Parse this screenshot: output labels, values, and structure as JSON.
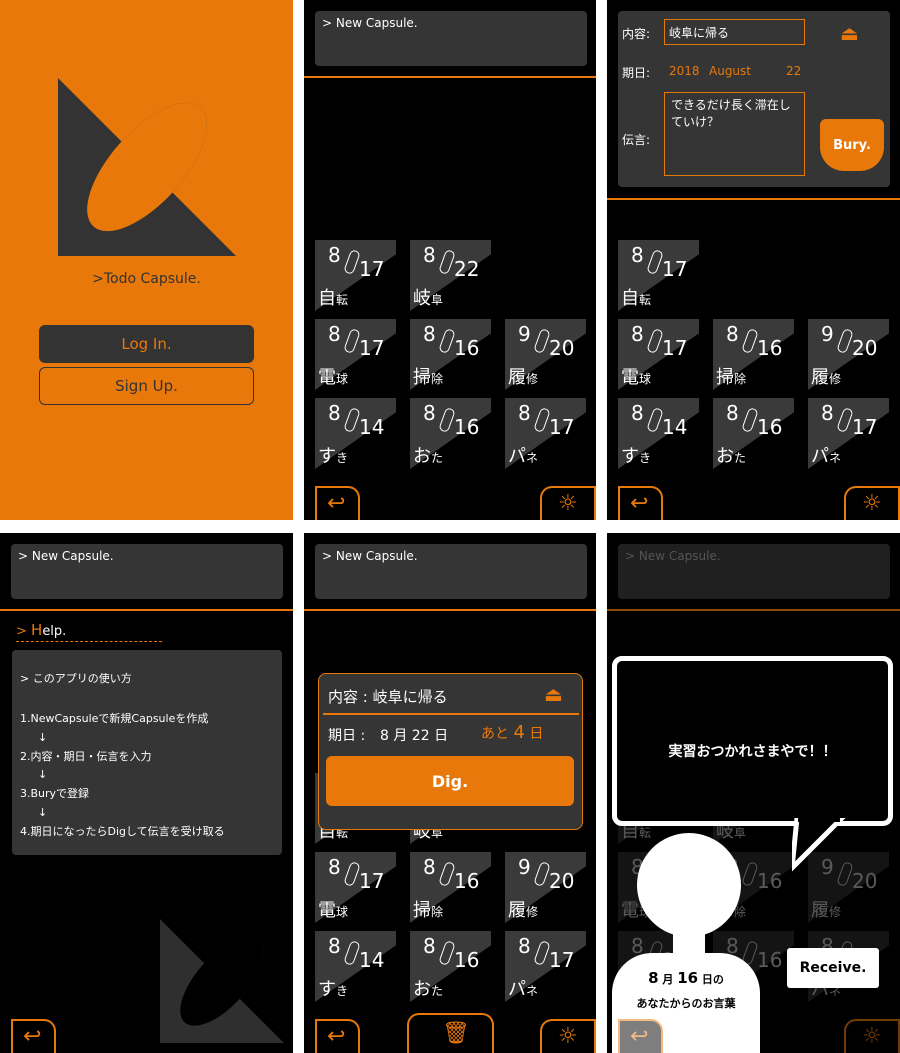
{
  "login": {
    "brand": ">Todo Capsule.",
    "login_label": "Log In.",
    "signup_label": "Sign Up."
  },
  "cmd": {
    "new_capsule": "> New Capsule."
  },
  "tiles": [
    {
      "month": "8",
      "day": "17",
      "t1": "自",
      "t2": "転"
    },
    {
      "month": "8",
      "day": "22",
      "t1": "岐",
      "t2": "阜"
    },
    {
      "month": "8",
      "day": "17",
      "t1": "電",
      "t2": "球"
    },
    {
      "month": "8",
      "day": "16",
      "t1": "掃",
      "t2": "除"
    },
    {
      "month": "9",
      "day": "20",
      "t1": "履",
      "t2": "修"
    },
    {
      "month": "8",
      "day": "14",
      "t1": "す",
      "t2": "き"
    },
    {
      "month": "8",
      "day": "16",
      "t1": "お",
      "t2": "た"
    },
    {
      "month": "8",
      "day": "17",
      "t1": "パ",
      "t2": "ネ"
    }
  ],
  "bury": {
    "content_label": "内容:",
    "content_value": "岐阜に帰る",
    "date_label": "期日:",
    "date_year": "2018",
    "date_month": "August",
    "date_day": "22",
    "message_label": "伝言:",
    "message_value": "できるだけ長く滞在していけ？",
    "bury_label": "Bury."
  },
  "help": {
    "title_prefix": "> ",
    "title_h": "H",
    "title_rest": "elp.",
    "box_title": "> このアプリの使い方",
    "steps": [
      "1.NewCapsuleで新規Capsuleを作成",
      "↓",
      "2.内容・期日・伝言を入力",
      "↓",
      "3.Buryで登録",
      "↓",
      "4.期日になったらDigして伝言を受け取る"
    ]
  },
  "dig": {
    "content": "内容 : 岐阜に帰る",
    "date_label": "期日 :",
    "date_value": "8 月 22 日",
    "remaining_prefix": "あと",
    "remaining_num": "4",
    "remaining_suffix": "日",
    "dig_label": "Dig."
  },
  "receive": {
    "message": "実習おつかれさまやで！！",
    "date_month": "8",
    "date_m_unit": "月",
    "date_day": "16",
    "date_d_unit": "日の",
    "from": "あなたからのお言葉",
    "receive_label": "Receive."
  },
  "colors": {
    "accent": "#E8780A",
    "tile": "#3a3a3a",
    "panel": "#000000"
  }
}
